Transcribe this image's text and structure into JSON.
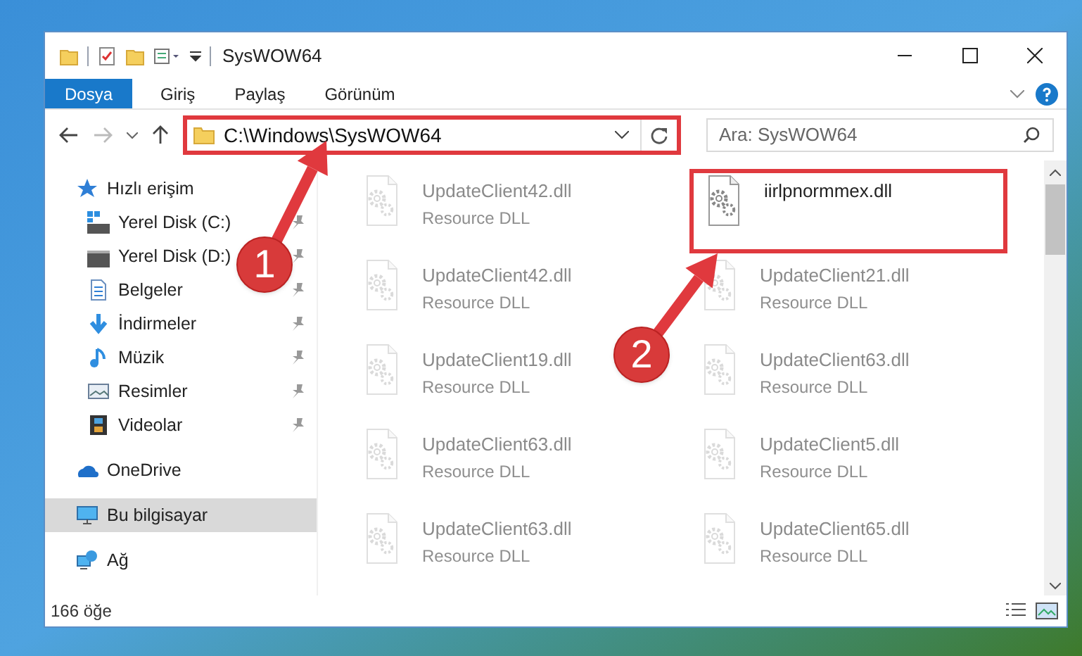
{
  "window": {
    "title": "SysWOW64"
  },
  "ribbon_tabs": [
    {
      "label": "Dosya",
      "selected": true
    },
    {
      "label": "Giriş",
      "selected": false
    },
    {
      "label": "Paylaş",
      "selected": false
    },
    {
      "label": "Görünüm",
      "selected": false
    }
  ],
  "address": {
    "path": "C:\\Windows\\SysWOW64",
    "highlighted": true
  },
  "search": {
    "placeholder": "Ara: SysWOW64"
  },
  "sidebar": {
    "items": [
      {
        "label": "Hızlı erişim",
        "kind": "star",
        "pinned": false,
        "selected": false
      },
      {
        "label": "Yerel Disk (C:)",
        "kind": "system-drive",
        "pinned": true,
        "selected": false
      },
      {
        "label": "Yerel Disk (D:)",
        "kind": "drive",
        "pinned": true,
        "selected": false
      },
      {
        "label": "Belgeler",
        "kind": "document",
        "pinned": true,
        "selected": false
      },
      {
        "label": "İndirmeler",
        "kind": "download",
        "pinned": true,
        "selected": false
      },
      {
        "label": "Müzik",
        "kind": "music",
        "pinned": true,
        "selected": false
      },
      {
        "label": "Resimler",
        "kind": "picture",
        "pinned": true,
        "selected": false
      },
      {
        "label": "Videolar",
        "kind": "video",
        "pinned": true,
        "selected": false
      },
      {
        "label": "OneDrive",
        "kind": "cloud",
        "pinned": false,
        "selected": false
      },
      {
        "label": "Bu bilgisayar",
        "kind": "computer",
        "pinned": false,
        "selected": true
      },
      {
        "label": "Ağ",
        "kind": "network",
        "pinned": false,
        "selected": false
      }
    ]
  },
  "files": [
    {
      "name": "UpdateClient42.dll",
      "type": "Resource DLL",
      "dimmed": true,
      "highlighted": false
    },
    {
      "name": "iirlpnormmex.dll",
      "dimmed": false,
      "highlighted": true
    },
    {
      "name": "UpdateClient42.dll",
      "type": "Resource DLL",
      "dimmed": true,
      "highlighted": false
    },
    {
      "name": "UpdateClient21.dll",
      "type": "Resource DLL",
      "dimmed": true,
      "highlighted": false
    },
    {
      "name": "UpdateClient19.dll",
      "type": "Resource DLL",
      "dimmed": true,
      "highlighted": false
    },
    {
      "name": "UpdateClient63.dll",
      "type": "Resource DLL",
      "dimmed": true,
      "highlighted": false
    },
    {
      "name": "UpdateClient63.dll",
      "type": "Resource DLL",
      "dimmed": true,
      "highlighted": false
    },
    {
      "name": "UpdateClient5.dll",
      "type": "Resource DLL",
      "dimmed": true,
      "highlighted": false
    },
    {
      "name": "UpdateClient63.dll",
      "type": "Resource DLL",
      "dimmed": true,
      "highlighted": false
    },
    {
      "name": "UpdateClient65.dll",
      "type": "Resource DLL",
      "dimmed": true,
      "highlighted": false
    }
  ],
  "status_bar": {
    "item_count": "166 öğe"
  },
  "annotations": [
    {
      "label": "1"
    },
    {
      "label": "2"
    }
  ]
}
